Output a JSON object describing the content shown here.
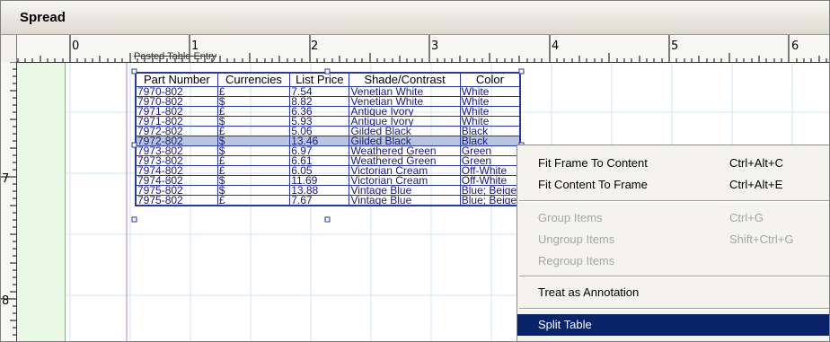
{
  "window": {
    "title": "Spread"
  },
  "ruler": {
    "horizontal_labels": [
      "0",
      "1",
      "2",
      "3",
      "4",
      "5",
      "6"
    ],
    "vertical_labels": [
      "7",
      "8"
    ]
  },
  "text_frame": {
    "faint_text": "",
    "struck_text": "Pasted Table Entry",
    "headers": [
      "Part Number",
      "Currencies",
      "List Price",
      "Shade/Contrast",
      "Color"
    ],
    "rows": [
      [
        "7970-802",
        "£",
        "7.54",
        "Venetian White",
        "White"
      ],
      [
        "7970-802",
        "$",
        "8.82",
        "Venetian White",
        "White"
      ],
      [
        "7971-802",
        "£",
        "6.36",
        "Antique Ivory",
        "White"
      ],
      [
        "7971-802",
        "$",
        "5.93",
        "Antique Ivory",
        "White"
      ],
      [
        "7972-802",
        "£",
        "5.06",
        "Gilded Black",
        "Black"
      ],
      [
        "7972-802",
        "$",
        "13.46",
        "Gilded Black",
        "Black"
      ],
      [
        "7973-802",
        "$",
        "6.97",
        "Weathered Green",
        "Green"
      ],
      [
        "7973-802",
        "£",
        "6.61",
        "Weathered Green",
        "Green"
      ],
      [
        "7974-802",
        "£",
        "6.05",
        "Victorian Cream",
        "Off-White"
      ],
      [
        "7974-802",
        "$",
        "11.69",
        "Victorian Cream",
        "Off-White"
      ],
      [
        "7975-802",
        "$",
        "13.88",
        "Vintage Blue",
        "Blue; Beige"
      ],
      [
        "7975-802",
        "£",
        "7.67",
        "Vintage Blue",
        "Blue; Beige"
      ]
    ],
    "selected_row_index": 5
  },
  "context_menu": {
    "items": [
      {
        "label": "Fit Frame To Content",
        "shortcut": "Ctrl+Alt+C",
        "enabled": true
      },
      {
        "label": "Fit Content To Frame",
        "shortcut": "Ctrl+Alt+E",
        "enabled": true
      },
      {
        "label": "Group Items",
        "shortcut": "Ctrl+G",
        "enabled": false
      },
      {
        "label": "Ungroup Items",
        "shortcut": "Shift+Ctrl+G",
        "enabled": false
      },
      {
        "label": "Regroup Items",
        "shortcut": "",
        "enabled": false
      },
      {
        "label": "Treat as Annotation",
        "shortcut": "",
        "enabled": true
      },
      {
        "label": "Split Table",
        "shortcut": "",
        "enabled": true,
        "highlighted": true
      }
    ]
  },
  "colors": {
    "table_border": "#2a3a9a",
    "selection_row": "#b8c4e0",
    "menu_highlight": "#0a246a",
    "gutter": "#eaf9e6"
  }
}
